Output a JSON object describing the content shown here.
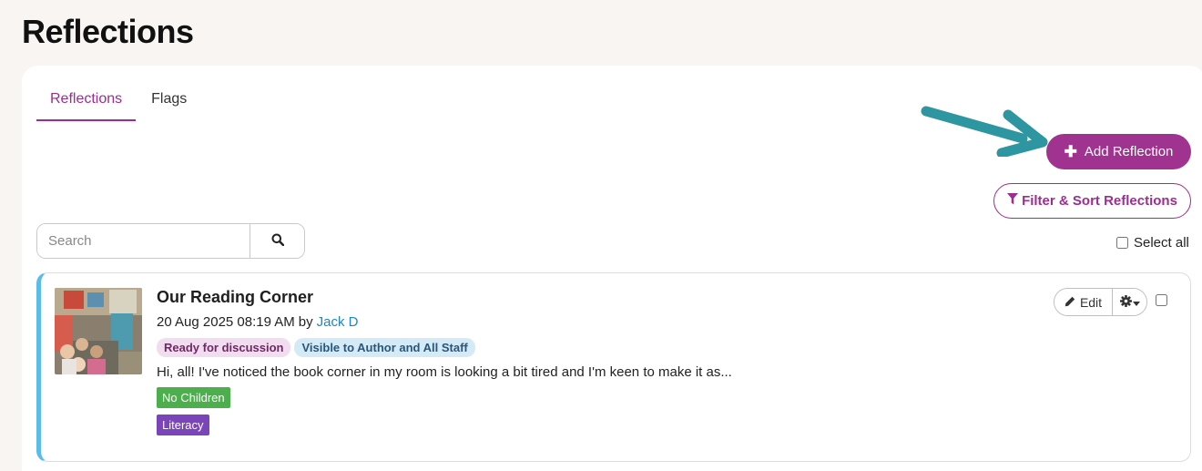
{
  "page": {
    "title": "Reflections"
  },
  "tabs": [
    {
      "label": "Reflections",
      "active": true
    },
    {
      "label": "Flags",
      "active": false
    }
  ],
  "toolbar": {
    "add_label": "Add Reflection",
    "filter_label": "Filter & Sort Reflections",
    "select_all_label": "Select all"
  },
  "search": {
    "placeholder": "Search",
    "value": ""
  },
  "icons": {
    "add": "plus-icon",
    "filter": "filter-icon",
    "search": "search-icon",
    "edit": "pencil-icon",
    "options": "gear-icon",
    "callout": "arrow-icon"
  },
  "colors": {
    "brand": "#a0338f",
    "card_accent": "#5bbcea",
    "callout_arrow": "#2e96a0",
    "tag_children": "#4cae4c",
    "tag_literacy": "#7a45b8"
  },
  "reflections": [
    {
      "title": "Our Reading Corner",
      "date": "20 Aug 2025 08:19 AM",
      "by": "by",
      "author": "Jack D",
      "badges": [
        "Ready for discussion",
        "Visible to Author and All Staff"
      ],
      "excerpt": "Hi, all! I've noticed the book corner in my room is looking a bit tired and I'm keen to make it as...",
      "children_tag": "No Children",
      "topic_tag": "Literacy",
      "edit_label": "Edit"
    }
  ]
}
